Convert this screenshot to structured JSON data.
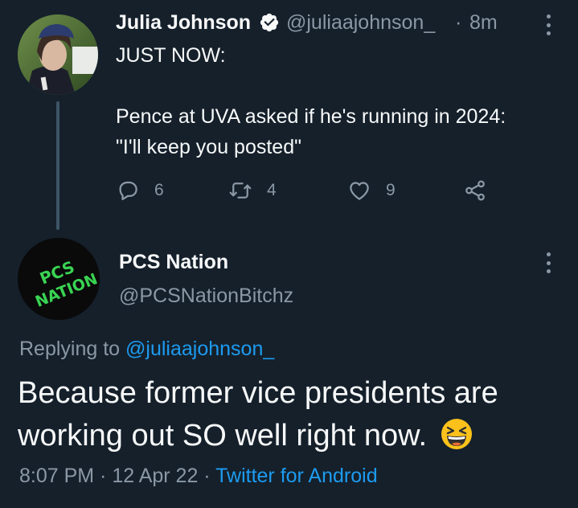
{
  "parent_tweet": {
    "display_name": "Julia Johnson",
    "verified": true,
    "handle": "@juliaajohnson_",
    "separator": "·",
    "time_ago": "8m",
    "text_line1": "JUST NOW:",
    "text_line2": "Pence at UVA asked if he's running in 2024:",
    "text_line3": "\"I'll keep you posted\"",
    "reply_count": "6",
    "retweet_count": "4",
    "like_count": "9"
  },
  "reply_tweet": {
    "display_name": "PCS Nation",
    "handle": "@PCSNationBitchz",
    "avatar_text_line1": "PCS",
    "avatar_text_line2": "NATION",
    "replying_prefix": "Replying to ",
    "replying_handle": "@juliaajohnson_",
    "text_line1": "Because former vice presidents are",
    "text_line2": "working out SO well right now.",
    "emoji": "grinning-squinting-face",
    "time": "8:07 PM",
    "date": "12 Apr 22",
    "separator": " · ",
    "source": "Twitter for Android"
  },
  "colors": {
    "background": "#15202b",
    "text_primary": "#f7f9f9",
    "text_secondary": "#8b98a5",
    "link": "#1d9bf0",
    "thread_line": "#3d5466",
    "avatar_text_green": "#39d353"
  }
}
